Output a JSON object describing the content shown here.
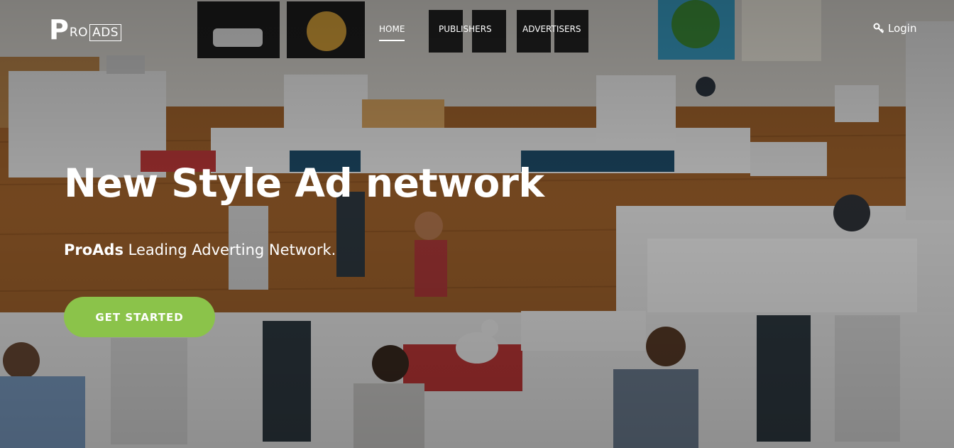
{
  "brand": {
    "logo_p": "P",
    "logo_ro": "RO",
    "logo_ads": "ADS"
  },
  "nav": {
    "items": [
      {
        "label": "HOME",
        "active": true
      },
      {
        "label": "PUBLISHERS",
        "active": false
      },
      {
        "label": "ADVERTISERS",
        "active": false
      }
    ],
    "login_label": "Login",
    "login_icon": "key-icon"
  },
  "hero": {
    "headline": "New Style Ad network",
    "subline_brand": "ProAds",
    "subline_rest": " Leading Adverting Network.",
    "cta_label": "GET STARTED"
  },
  "colors": {
    "accent": "#8bc34a",
    "text": "#ffffff"
  }
}
